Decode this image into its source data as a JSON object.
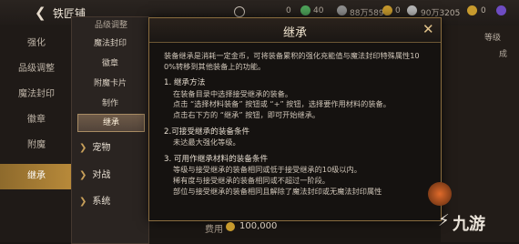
{
  "topbar": {
    "back_icon": "back-arrow-icon",
    "title": "铁匠铺",
    "res1": "0",
    "res2": "40",
    "gold": "88万5890",
    "res3": "0",
    "silver": "90万3205",
    "res4": "0"
  },
  "sidebar": {
    "items": [
      {
        "label": "强化"
      },
      {
        "label": "品级调整"
      },
      {
        "label": "魔法封印"
      },
      {
        "label": "徽章"
      },
      {
        "label": "附魔"
      },
      {
        "label": "继承"
      }
    ]
  },
  "subpanel": {
    "top": "品级调整",
    "items": [
      {
        "label": "魔法封印"
      },
      {
        "label": "徽章"
      },
      {
        "label": "附魔卡片"
      },
      {
        "label": "制作"
      },
      {
        "label": "继承"
      }
    ],
    "cats": [
      {
        "label": "宠物"
      },
      {
        "label": "对战"
      },
      {
        "label": "系统"
      }
    ]
  },
  "dialog": {
    "title": "继承",
    "intro1": "装备继承是消耗一定金币，可将装备累积的强化充能值与魔法封印特殊属性10",
    "intro2": "0%转移到其他装备上的功能。",
    "s1_title": "1. 继承方法",
    "s1_l1": "在装备目录中选择接受继承的装备。",
    "s1_l2": "点击 “选择材料装备” 按钮或 “+” 按钮，选择要作用材料的装备。",
    "s1_l3": "点击右下方的 “继承” 按钮，即可开始继承。",
    "s2_title": "2.可接受继承的装备条件",
    "s2_l1": "未达最大强化等级。",
    "s3_title": "3. 可用作继承材料的装备条件",
    "s3_l1": "等级与接受继承的装备相同或低于接受继承的10级以内。",
    "s3_l2": "稀有度与接受继承的装备相同或不超过一阶段。",
    "s3_l3": "部位与接受继承的装备相同且解除了魔法封印或无魔法封印属性"
  },
  "right": {
    "hint1": "等级",
    "hint2": "成"
  },
  "bottom": {
    "cost_label": "费用",
    "cost_value": "100,000"
  },
  "watermark": {
    "mark": "⚡",
    "text": "九游"
  }
}
